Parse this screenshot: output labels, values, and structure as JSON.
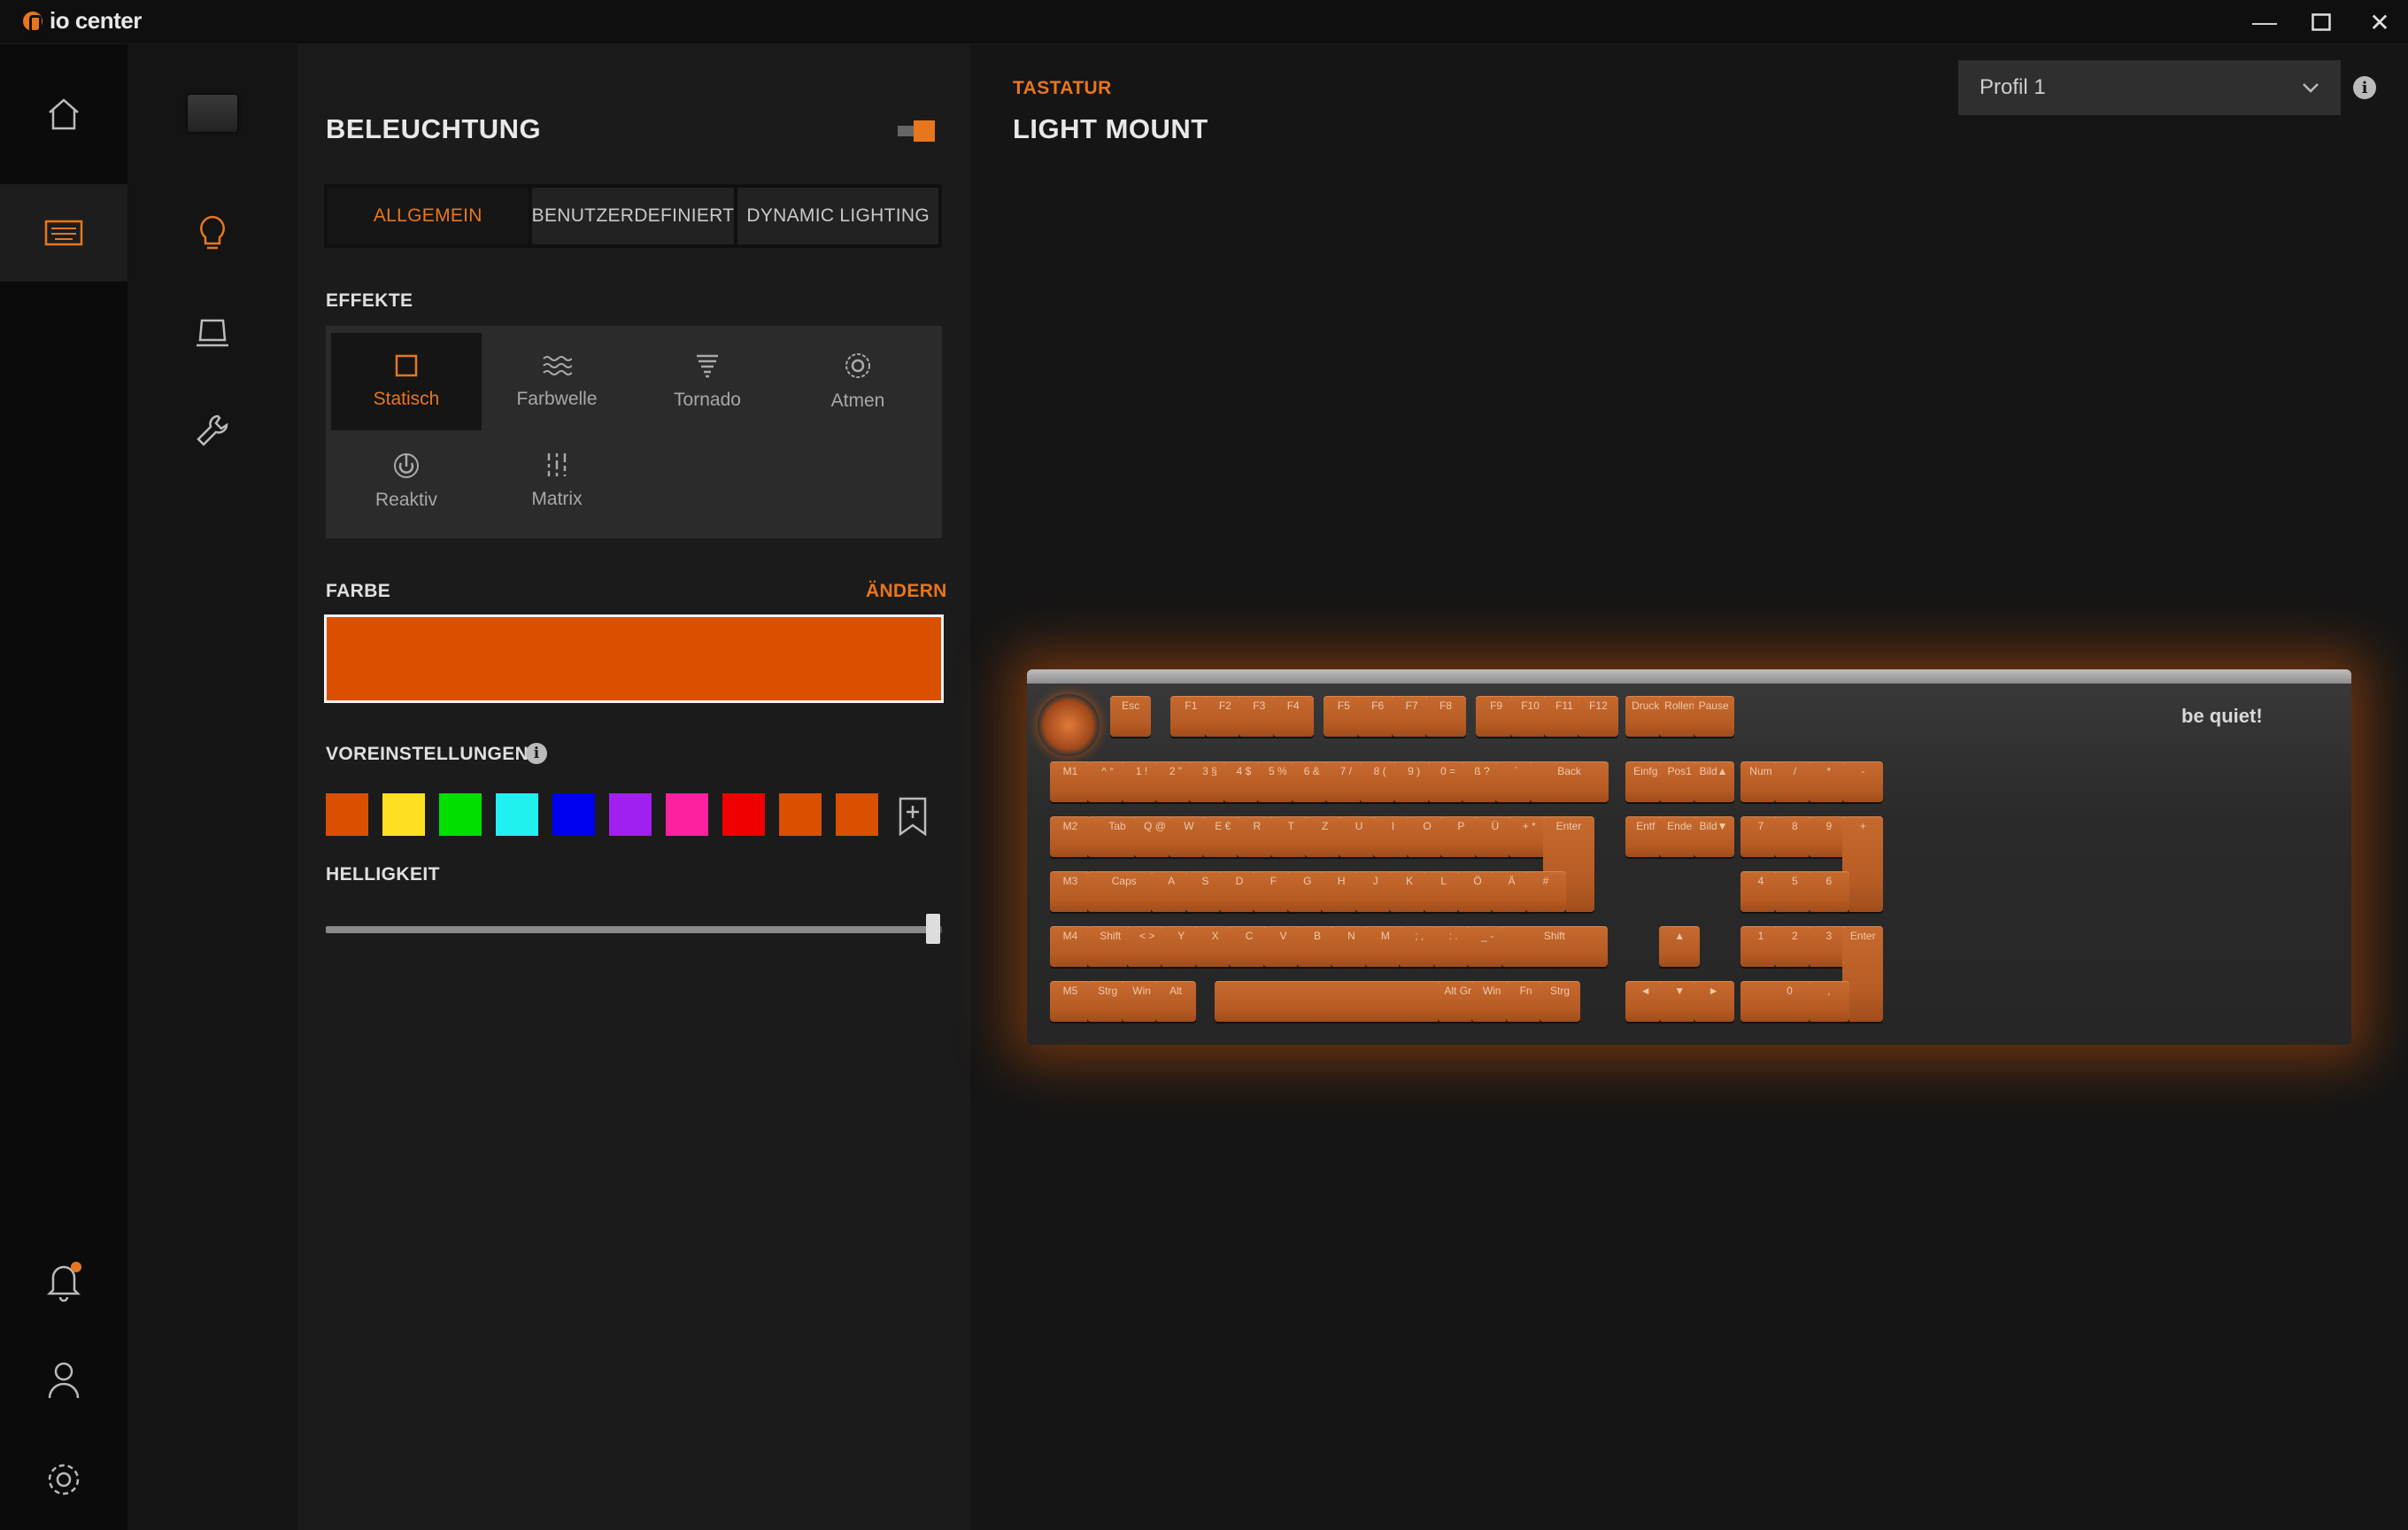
{
  "window": {
    "title": "io center",
    "controls": {
      "minimize": "—",
      "maximize": "☐",
      "close": "✕"
    }
  },
  "panel": {
    "title": "BELEUCHTUNG",
    "tabs": [
      "ALLGEMEIN",
      "BENUTZERDEFINIERT",
      "DYNAMIC LIGHTING"
    ],
    "effects_label": "EFFEKTE",
    "effects": [
      {
        "label": "Statisch",
        "icon": "square-icon"
      },
      {
        "label": "Farbwelle",
        "icon": "wave-icon"
      },
      {
        "label": "Tornado",
        "icon": "tornado-icon"
      },
      {
        "label": "Atmen",
        "icon": "breathe-icon"
      },
      {
        "label": "Reaktiv",
        "icon": "reactive-icon"
      },
      {
        "label": "Matrix",
        "icon": "matrix-icon"
      }
    ],
    "color_label": "FARBE",
    "change_label": "ÄNDERN",
    "selected_color": "#d85000",
    "presets_label": "VOREINSTELLUNGEN",
    "presets": [
      "#d85000",
      "#ffe020",
      "#00e000",
      "#20f0f0",
      "#0000f0",
      "#a020f0",
      "#ff20a0",
      "#f00000",
      "#d85000",
      "#d85000"
    ],
    "brightness_label": "HELLIGKEIT",
    "brightness": 0.99
  },
  "main": {
    "category": "TASTATUR",
    "device_name": "LIGHT MOUNT",
    "profile": "Profil 1",
    "brand": "be quiet!"
  },
  "keyboard": {
    "rows": [
      [
        "Esc",
        "F1",
        "F2",
        "F3",
        "F4",
        "F5",
        "F6",
        "F7",
        "F8",
        "F9",
        "F10",
        "F11",
        "F12",
        "Druck",
        "Rollen",
        "Pause"
      ],
      [
        "M1",
        "^ °",
        "1 !",
        "2 \"",
        "3 §",
        "4 $",
        "5 %",
        "6 &",
        "7 /",
        "8 (",
        "9 )",
        "0 =",
        "ß ?",
        "´",
        "Back",
        "Einfg",
        "Pos1",
        "Bild▲",
        "Num",
        "/",
        "*",
        "-"
      ],
      [
        "M2",
        "Tab",
        "Q @",
        "W",
        "E €",
        "R",
        "T",
        "Z",
        "U",
        "I",
        "O",
        "P",
        "Ü",
        "+ *",
        "Enter",
        "Entf",
        "Ende",
        "Bild▼",
        "7",
        "8",
        "9",
        "+"
      ],
      [
        "M3",
        "Caps",
        "A",
        "S",
        "D",
        "F",
        "G",
        "H",
        "J",
        "K",
        "L",
        "Ö",
        "Ä",
        "#",
        "4",
        "5",
        "6"
      ],
      [
        "M4",
        "Shift",
        "< >",
        "Y",
        "X",
        "C",
        "V",
        "B",
        "N",
        "M",
        "; ,",
        ": .",
        "_ -",
        "Shift",
        "▲",
        "1",
        "2",
        "3",
        "Enter"
      ],
      [
        "M5",
        "Strg",
        "Win",
        "Alt",
        "",
        "Alt Gr",
        "Win",
        "Fn",
        "Strg",
        "◄",
        "▼",
        "►",
        "0",
        ","
      ]
    ]
  }
}
